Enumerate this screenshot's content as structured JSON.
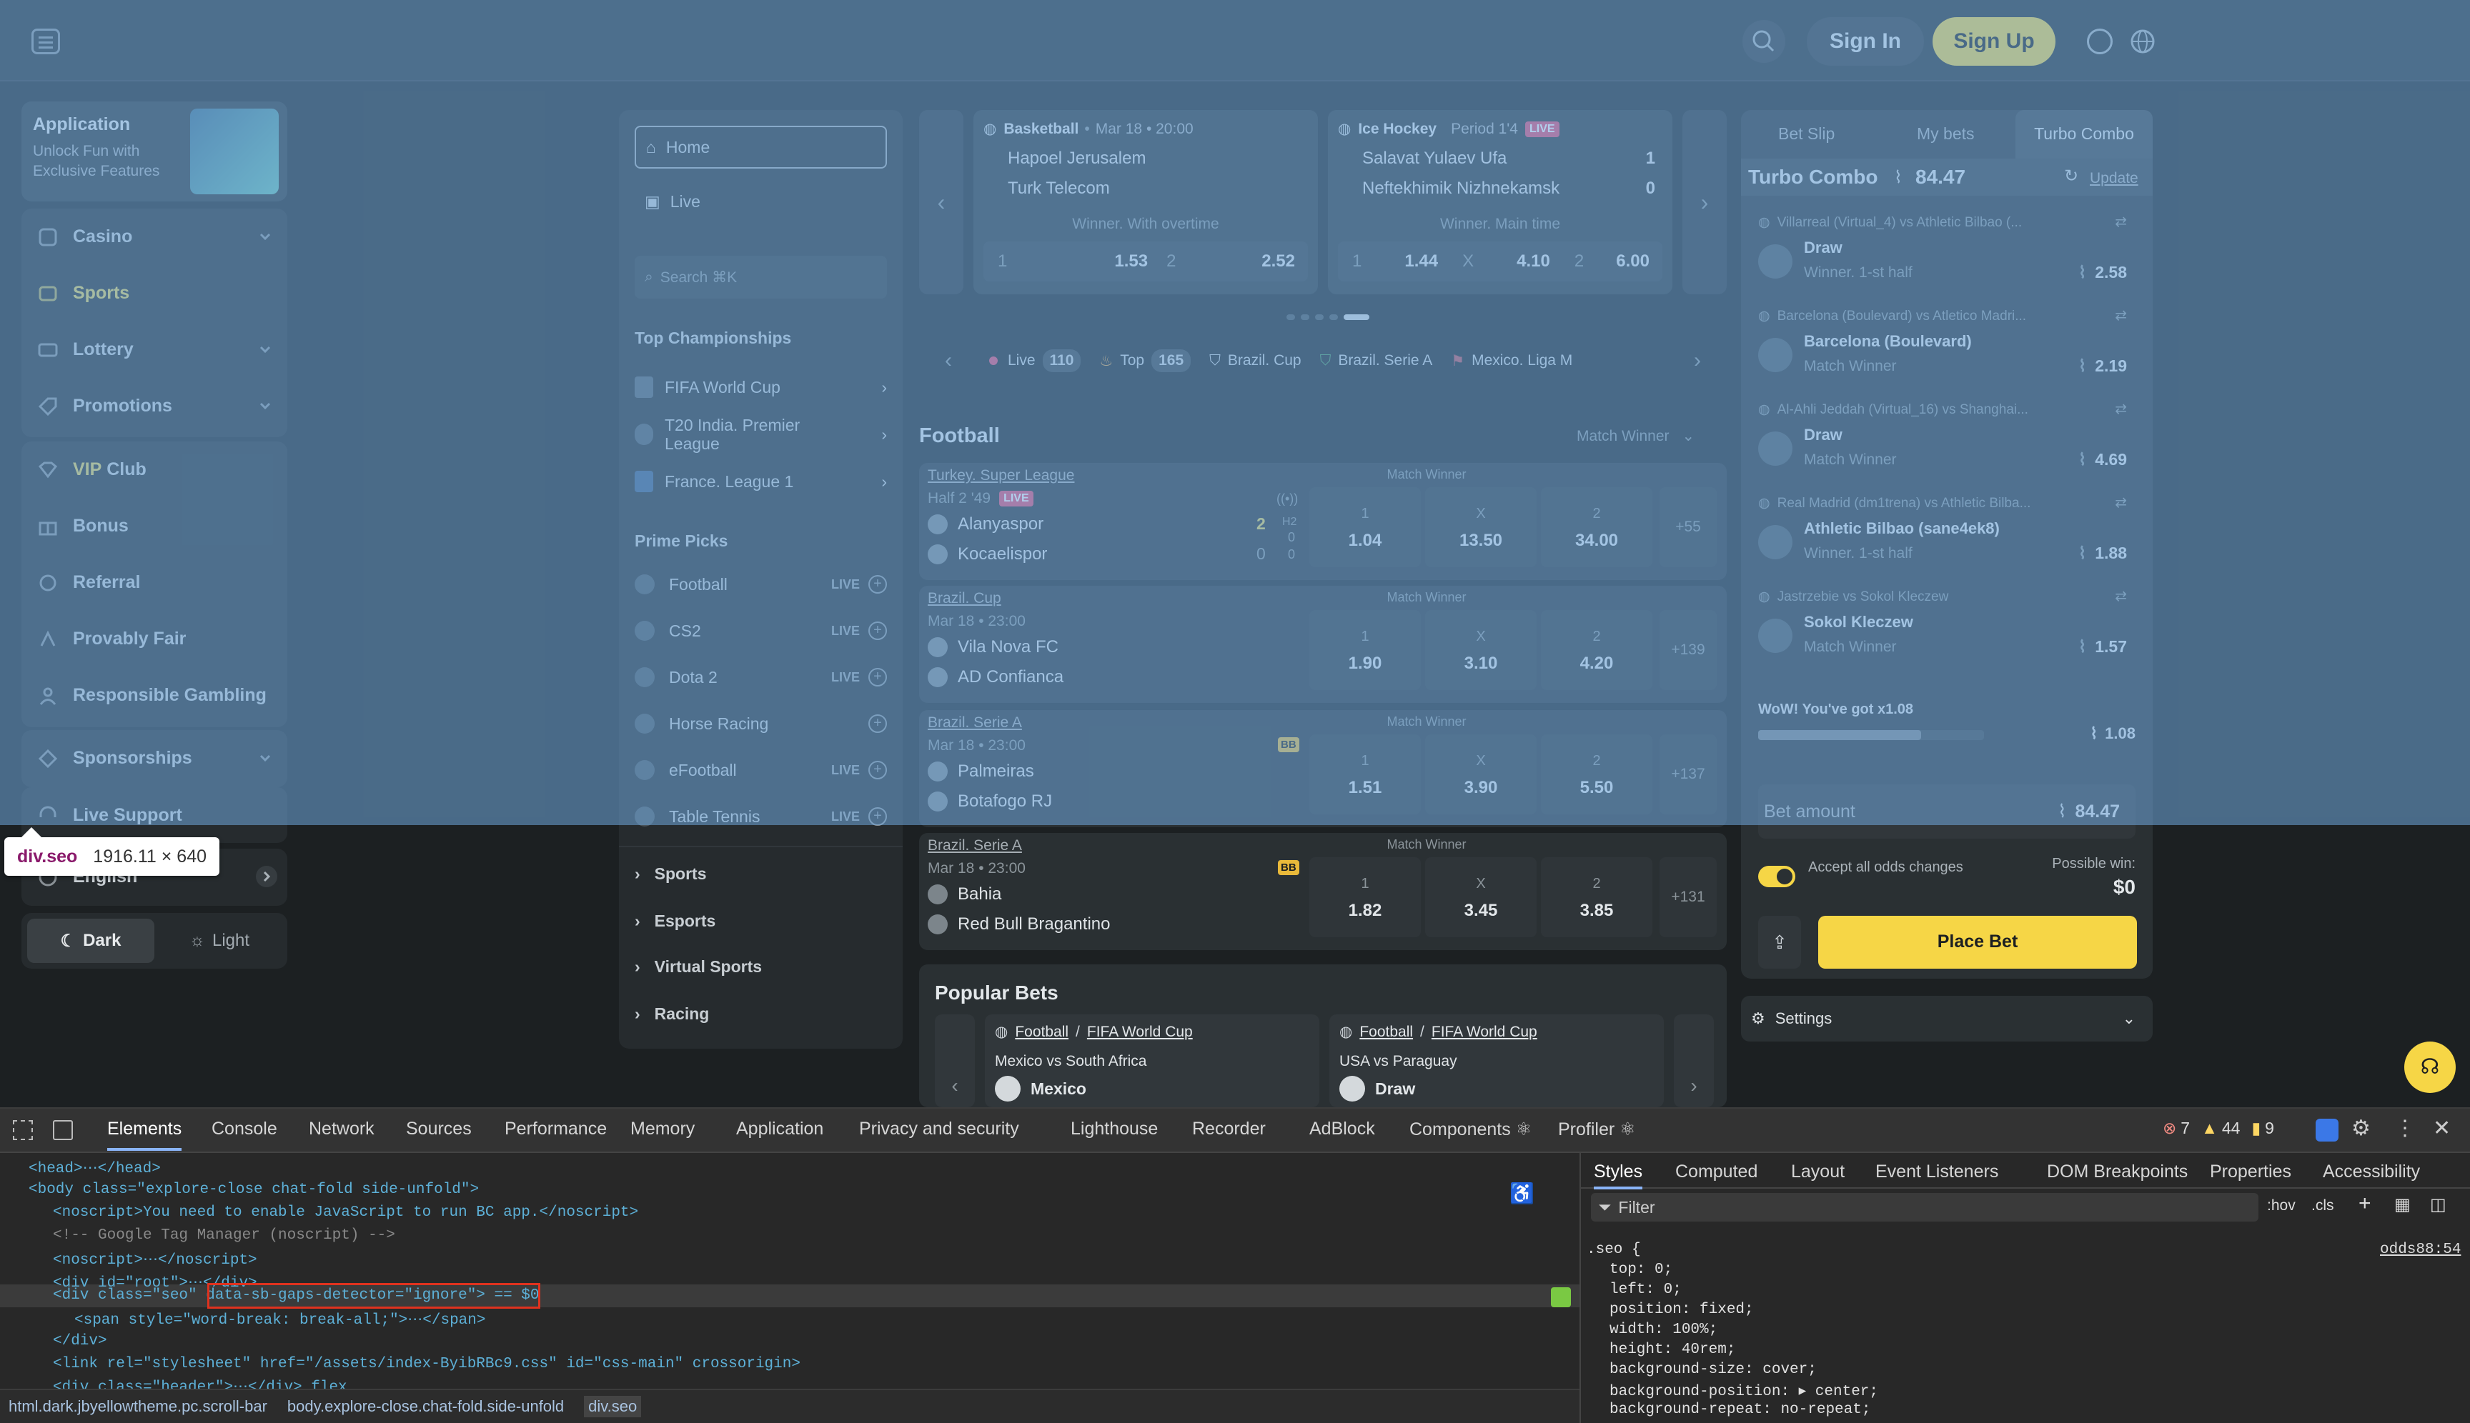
{
  "header": {
    "signin": "Sign In",
    "signup": "Sign Up"
  },
  "app_promo": {
    "title": "Application",
    "subtitle_1": "Unlock Fun with",
    "subtitle_2": "Exclusive Features"
  },
  "leftnav": {
    "items": [
      {
        "label": "Casino",
        "icon": "casino-icon",
        "chevron": true
      },
      {
        "label": "Sports",
        "icon": "sports-icon",
        "chevron": false,
        "active": true
      },
      {
        "label": "Lottery",
        "icon": "lottery-icon",
        "chevron": true
      },
      {
        "label": "Promotions",
        "icon": "promotions-icon",
        "chevron": true
      }
    ],
    "vip_prefix": "VIP",
    "vip_suffix": " Club",
    "items2": [
      {
        "label": "Bonus",
        "icon": "bonus-icon"
      },
      {
        "label": "Referral",
        "icon": "referral-icon"
      },
      {
        "label": "Provably Fair",
        "icon": "provably-fair-icon"
      },
      {
        "label": "Responsible Gambling",
        "icon": "responsible-gambling-icon"
      }
    ],
    "sponsorships": "Sponsorships",
    "live_support": "Live Support",
    "language": "English",
    "dark": "Dark",
    "light": "Light"
  },
  "tooltip": {
    "name": "div.seo",
    "size": "1916.11 × 640"
  },
  "mid": {
    "home": "Home",
    "live": "Live",
    "search_placeholder": "Search ⌘K",
    "top_champ_title": "Top Championships",
    "champs": [
      "FIFA World Cup",
      "T20 India. Premier League",
      "France. League 1"
    ],
    "prime_title": "Prime Picks",
    "prime": [
      {
        "label": "Football",
        "live": "LIVE"
      },
      {
        "label": "CS2",
        "live": "LIVE"
      },
      {
        "label": "Dota 2",
        "live": "LIVE"
      },
      {
        "label": "Horse Racing",
        "live": ""
      },
      {
        "label": "eFootball",
        "live": "LIVE"
      },
      {
        "label": "Table Tennis",
        "live": "LIVE"
      }
    ],
    "sections": [
      "Sports",
      "Esports",
      "Virtual Sports",
      "Racing"
    ]
  },
  "featured": [
    {
      "sport": "Basketball",
      "time": "Mar 18 • 20:00",
      "status": "",
      "team1": "Hapoel Jerusalem",
      "team2": "Turk Telecom",
      "s1": "",
      "s2": "",
      "market": "Winner. With overtime",
      "o1": "1",
      "v1": "1.53",
      "o2": "2",
      "v2": "2.52",
      "ox": "",
      "vx": ""
    },
    {
      "sport": "Ice Hockey",
      "time": "Period 1'4",
      "status": "LIVE",
      "team1": "Salavat Yulaev Ufa",
      "team2": "Neftekhimik Nizhnekamsk",
      "s1": "1",
      "s2": "0",
      "market": "Winner. Main time",
      "o1": "1",
      "v1": "1.44",
      "ox": "X",
      "vx": "4.10",
      "o2": "2",
      "v2": "6.00"
    }
  ],
  "filters": [
    {
      "label": "Live",
      "count": "110"
    },
    {
      "label": "Top",
      "count": "165"
    },
    {
      "label": "Brazil. Cup",
      "count": ""
    },
    {
      "label": "Brazil. Serie A",
      "count": ""
    },
    {
      "label": "Mexico. Liga M",
      "count": ""
    }
  ],
  "football": {
    "title": "Football",
    "market_select": "Match Winner"
  },
  "matches": [
    {
      "league": "Turkey. Super League",
      "time": "Half 2 '49",
      "live": "LIVE",
      "team1": "Alanyaspor",
      "team2": "Kocaelispor",
      "s1": "2",
      "s2": "0",
      "h1": "0",
      "h2": "0",
      "ht": "H2",
      "market": "Match Winner",
      "v1": "1.04",
      "vx": "13.50",
      "v2": "34.00",
      "more": "+55"
    },
    {
      "league": "Brazil. Cup",
      "time": "Mar 18 • 23:00",
      "live": "",
      "team1": "Vila Nova FC",
      "team2": "AD Confianca",
      "market": "Match Winner",
      "v1": "1.90",
      "vx": "3.10",
      "v2": "4.20",
      "more": "+139"
    },
    {
      "league": "Brazil. Serie A",
      "time": "Mar 18 • 23:00",
      "live": "",
      "team1": "Palmeiras",
      "team2": "Botafogo RJ",
      "market": "Match Winner",
      "v1": "1.51",
      "vx": "3.90",
      "v2": "5.50",
      "more": "+137",
      "bb": "BB"
    },
    {
      "league": "Brazil. Serie A",
      "time": "Mar 18 • 23:00",
      "live": "",
      "team1": "Bahia",
      "team2": "Red Bull Bragantino",
      "market": "Match Winner",
      "v1": "1.82",
      "vx": "3.45",
      "v2": "3.85",
      "more": "+131",
      "bb": "BB"
    }
  ],
  "odds_labels": {
    "l1": "1",
    "lx": "X",
    "l2": "2"
  },
  "popular": {
    "title": "Popular Bets",
    "cards": [
      {
        "sport": "Football",
        "league": "FIFA World Cup",
        "match": "Mexico vs South Africa",
        "pick": "Mexico"
      },
      {
        "sport": "Football",
        "league": "FIFA World Cup",
        "match": "USA vs Paraguay",
        "pick": "Draw"
      }
    ]
  },
  "betslip": {
    "tabs": [
      "Bet Slip",
      "My bets",
      "Turbo Combo"
    ],
    "combo_title": "Turbo Combo",
    "combo_odds": "84.47",
    "update": "Update",
    "items": [
      {
        "match": "Villarreal (Virtual_4) vs Athletic Bilbao (...",
        "pick": "Draw",
        "market": "Winner. 1-st half",
        "odds": "2.58"
      },
      {
        "match": "Barcelona (Boulevard) vs Atletico Madri...",
        "pick": "Barcelona (Boulevard)",
        "market": "Match Winner",
        "odds": "2.19"
      },
      {
        "match": "Al-Ahli Jeddah (Virtual_16) vs Shanghai...",
        "pick": "Draw",
        "market": "Match Winner",
        "odds": "4.69"
      },
      {
        "match": "Real Madrid (dm1trena) vs Athletic Bilba...",
        "pick": "Athletic Bilbao (sane4ek8)",
        "market": "Winner. 1-st half",
        "odds": "1.88"
      },
      {
        "match": "Jastrzebie vs Sokol Kleczew",
        "pick": "Sokol Kleczew",
        "market": "Match Winner",
        "odds": "1.57"
      }
    ],
    "wow": "WoW! You've got x1.08",
    "boost": "1.08",
    "boost_progress": 0.72,
    "bet_amount": "Bet amount",
    "total": "84.47",
    "accept": "Accept all odds changes",
    "possible": "Possible win:",
    "possible_val": "$0",
    "place": "Place Bet",
    "settings": "Settings"
  },
  "devtools": {
    "tabs": [
      "Elements",
      "Console",
      "Network",
      "Sources",
      "Performance",
      "Memory",
      "Application",
      "Privacy and security",
      "Lighthouse",
      "Recorder",
      "AdBlock",
      "Components ⚛",
      "Profiler ⚛"
    ],
    "errors": "7",
    "warnings": "44",
    "issues": "9",
    "styles_tabs": [
      "Styles",
      "Computed",
      "Layout",
      "Event Listeners",
      "DOM Breakpoints",
      "Properties",
      "Accessibility"
    ],
    "filter": "Filter",
    "hov": ":hov",
    ".cls": ".cls",
    "breadcrumbs": [
      "html.dark.jbyellowtheme.pc.scroll-bar",
      "body.explore-close.chat-fold.side-unfold",
      "div.seo"
    ],
    "selector": ".seo {",
    "source": "odds88:54",
    "props": [
      "top: 0;",
      "left: 0;",
      "position: fixed;",
      "width: 100%;",
      "height: 40rem;",
      "background-size: cover;",
      "background-position: ▸ center;",
      "background-repeat: no-repeat;"
    ],
    "lines": [
      "<head>⋯</head>",
      "<body class=\"explore-close chat-fold side-unfold\">",
      "<noscript>You need to enable JavaScript to run BC app.</noscript>",
      "<!-- Google Tag Manager (noscript) -->",
      "<noscript>⋯</noscript>",
      "<div id=\"root\">⋯</div>",
      "<div class=\"seo\" data-sb-gaps-detector=\"ignore\"> == $0",
      "<span style=\"word-break: break-all;\">⋯</span>",
      "</div>",
      "<link rel=\"stylesheet\" href=\"/assets/index-ByibRBc9.css\" id=\"css-main\" crossorigin>",
      "<div class=\"header\">⋯</div> flex"
    ]
  },
  "colors": {
    "accent": "#f6d646",
    "live": "#e74c6f",
    "overlay": "#6fa8dc"
  }
}
